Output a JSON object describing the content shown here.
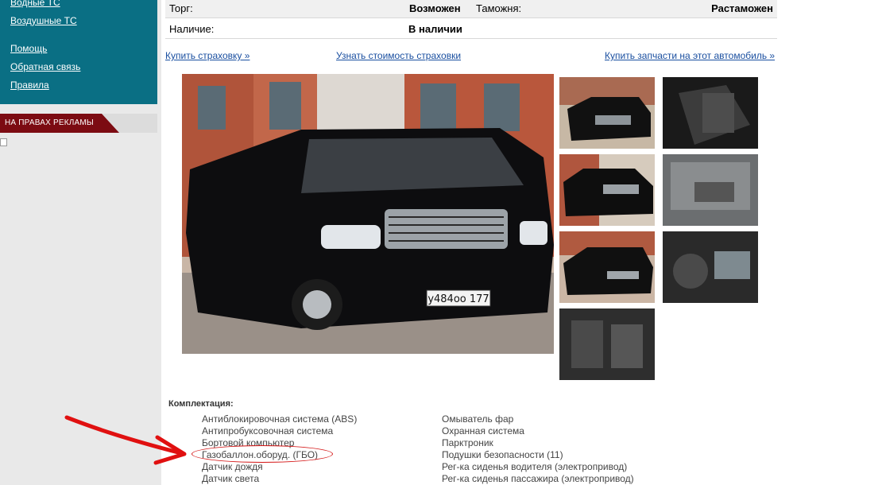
{
  "sidebar": {
    "links": [
      "Водные ТС",
      "Воздушные ТС",
      "Помощь",
      "Обратная связь",
      "Правила"
    ],
    "ad_header": "НА ПРАВАХ РЕКЛАМЫ"
  },
  "info": {
    "torg_label": "Торг:",
    "torg_value": "Возможен",
    "customs_label": "Таможня:",
    "customs_value": "Растаможен",
    "availability_label": "Наличие:",
    "availability_value": "В наличии"
  },
  "links": {
    "buy_insurance": "Купить страховку »",
    "insurance_cost": "Узнать стоимость страховки",
    "buy_parts": "Купить запчасти на этот автомобиль »"
  },
  "photo": {
    "plate": "у484оо 177"
  },
  "equipment": {
    "title": "Комплектация:",
    "left": [
      "Антиблокировочная система (ABS)",
      "Антипробуксовочная система",
      "Бортовой компьютер",
      "Газобаллон.оборуд. (ГБО)",
      "Датчик дождя",
      "Датчик света"
    ],
    "right": [
      "Омыватель фар",
      "Охранная система",
      "Парктроник",
      "Подушки безопасности (11)",
      "Рег-ка сиденья водителя (электропривод)",
      "Рег-ка сиденья пассажира (электропривод)"
    ]
  },
  "colors": {
    "sidebar_teal": "#0a6f84",
    "ad_red": "#7c0b12",
    "link_blue": "#1a4fa0",
    "highlight_red": "#d41414"
  }
}
